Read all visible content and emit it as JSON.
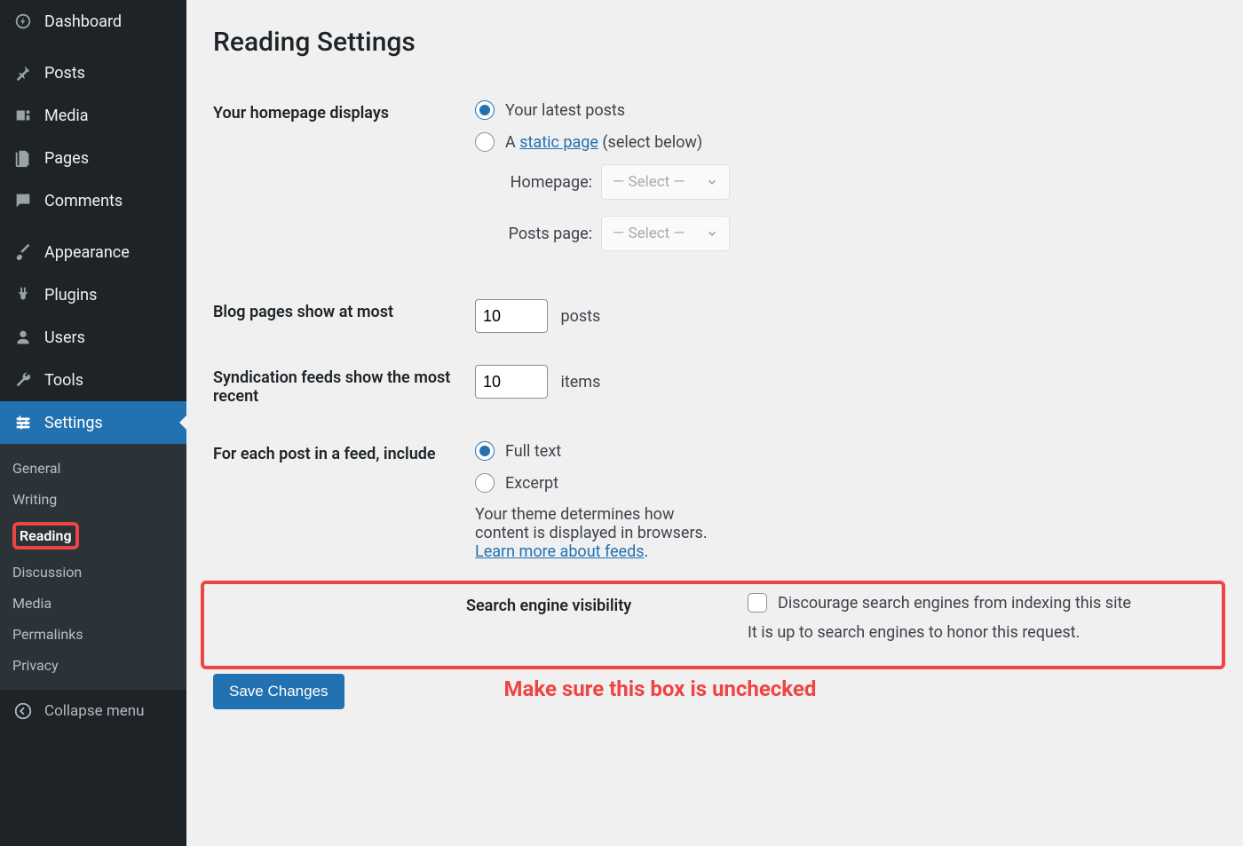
{
  "sidebar": {
    "dashboard": "Dashboard",
    "posts": "Posts",
    "media": "Media",
    "pages": "Pages",
    "comments": "Comments",
    "appearance": "Appearance",
    "plugins": "Plugins",
    "users": "Users",
    "tools": "Tools",
    "settings": "Settings",
    "collapse": "Collapse menu",
    "sub": {
      "general": "General",
      "writing": "Writing",
      "reading": "Reading",
      "discussion": "Discussion",
      "media": "Media",
      "permalinks": "Permalinks",
      "privacy": "Privacy"
    }
  },
  "page": {
    "title": "Reading Settings",
    "homepage_label": "Your homepage displays",
    "radio_latest": "Your latest posts",
    "radio_static_prefix": "A ",
    "radio_static_link": "static page",
    "radio_static_suffix": " (select below)",
    "homepage_sel_label": "Homepage:",
    "postspage_sel_label": "Posts page:",
    "select_placeholder": "— Select —",
    "blog_pages_label": "Blog pages show at most",
    "blog_pages_value": "10",
    "blog_pages_unit": "posts",
    "syndication_label": "Syndication feeds show the most recent",
    "syndication_value": "10",
    "syndication_unit": "items",
    "feed_include_label": "For each post in a feed, include",
    "radio_full": "Full text",
    "radio_excerpt": "Excerpt",
    "feed_desc_prefix": "Your theme determines how content is displayed in browsers. ",
    "feed_desc_link": "Learn more about feeds",
    "feed_desc_suffix": ".",
    "search_vis_label": "Search engine visibility",
    "discourage_label": "Discourage search engines from indexing this site",
    "discourage_desc": "It is up to search engines to honor this request.",
    "save": "Save Changes"
  },
  "annotation": {
    "text": "Make sure this box is unchecked"
  }
}
